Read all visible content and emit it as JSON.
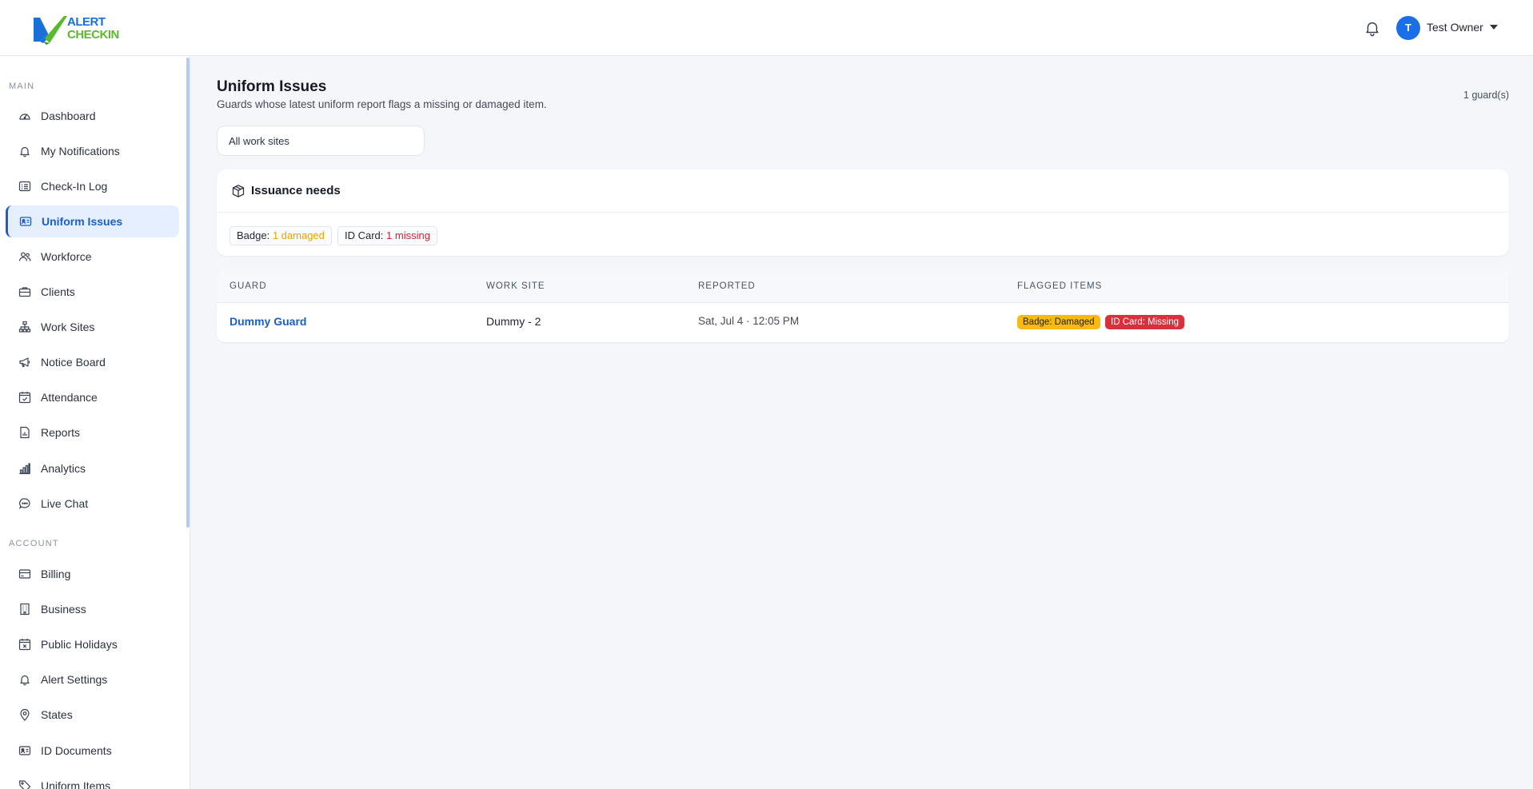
{
  "app": {
    "logo_line1": "ALERT",
    "logo_line2": "CHECKIN"
  },
  "header": {
    "avatar_initial": "T",
    "user_name": "Test Owner",
    "bell_icon": "bell-icon",
    "caret_icon": "caret-down-icon"
  },
  "sidebar": {
    "main_title": "MAIN",
    "main_items": [
      {
        "label": "Dashboard",
        "icon": "gauge-icon"
      },
      {
        "label": "My Notifications",
        "icon": "bell-icon"
      },
      {
        "label": "Check-In Log",
        "icon": "list-icon"
      },
      {
        "label": "Uniform Issues",
        "icon": "id-card-icon",
        "active": true
      },
      {
        "label": "Workforce",
        "icon": "people-icon"
      },
      {
        "label": "Clients",
        "icon": "briefcase-icon"
      },
      {
        "label": "Work Sites",
        "icon": "sitemap-icon"
      },
      {
        "label": "Notice Board",
        "icon": "megaphone-icon"
      },
      {
        "label": "Attendance",
        "icon": "calendar-check-icon"
      },
      {
        "label": "Reports",
        "icon": "report-icon"
      },
      {
        "label": "Analytics",
        "icon": "bar-chart-icon"
      },
      {
        "label": "Live Chat",
        "icon": "chat-icon"
      }
    ],
    "account_title": "ACCOUNT",
    "account_items": [
      {
        "label": "Billing",
        "icon": "credit-card-icon"
      },
      {
        "label": "Business",
        "icon": "building-icon"
      },
      {
        "label": "Public Holidays",
        "icon": "calendar-x-icon"
      },
      {
        "label": "Alert Settings",
        "icon": "bell-icon"
      },
      {
        "label": "States",
        "icon": "map-pin-icon"
      },
      {
        "label": "ID Documents",
        "icon": "id-card-icon"
      },
      {
        "label": "Uniform Items",
        "icon": "tag-icon"
      }
    ]
  },
  "main": {
    "title": "Uniform Issues",
    "subtitle": "Guards whose latest uniform report flags a missing or damaged item.",
    "guard_count": "1 guard(s)",
    "site_filter": "All work sites",
    "issuance": {
      "title": "Issuance needs",
      "icon": "box-icon",
      "chips": [
        {
          "key": "Badge:",
          "value": "1 damaged",
          "color": "#f0a000"
        },
        {
          "key": "ID Card:",
          "value": "1 missing",
          "color": "#d0202c"
        }
      ]
    },
    "table": {
      "headers": [
        "GUARD",
        "WORK SITE",
        "REPORTED",
        "FLAGGED ITEMS"
      ],
      "rows": [
        {
          "guard": "Dummy Guard",
          "work_site": "Dummy - 2",
          "reported": "Sat, Jul 4 · 12:05 PM",
          "flags": [
            {
              "label": "Badge: Damaged",
              "color": "#f8b913"
            },
            {
              "label": "ID Card: Missing",
              "color": "#d9303c"
            }
          ]
        }
      ]
    }
  }
}
